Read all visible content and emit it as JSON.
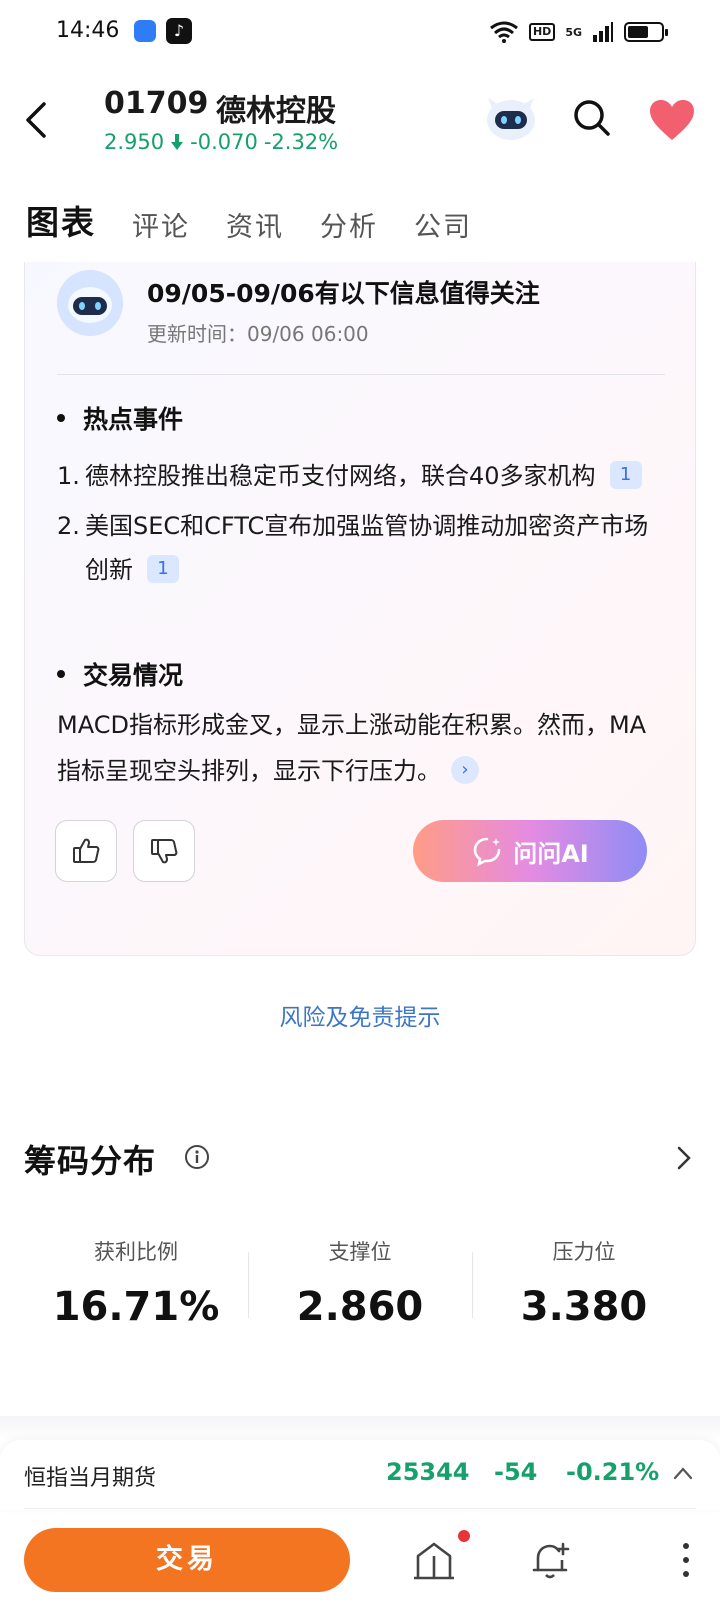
{
  "status_bar": {
    "time": "14:46",
    "hd": "HD",
    "network": "5G"
  },
  "header": {
    "code": "01709",
    "name": "德林控股",
    "price": "2.950",
    "change": "-0.070",
    "change_pct": "-2.32%",
    "colors": {
      "down": "#16a06b",
      "heart": "#f2606f"
    }
  },
  "tabs": [
    {
      "label": "图表",
      "active": true
    },
    {
      "label": "评论"
    },
    {
      "label": "资讯"
    },
    {
      "label": "分析"
    },
    {
      "label": "公司"
    }
  ],
  "ai_card": {
    "title": "09/05-09/06有以下信息值得关注",
    "updated": "更新时间：09/06 06:00",
    "hot_events_heading": "热点事件",
    "hot_events": [
      {
        "num": "1.",
        "text": "德林控股推出稳定币支付网络，联合40多家机构",
        "ref": "1"
      },
      {
        "num": "2.",
        "text": "美国SEC和CFTC宣布加强监管协调推动加密资产市场创新",
        "ref": "1"
      }
    ],
    "trading_heading": "交易情况",
    "trading_text": "MACD指标形成金叉，显示上涨动能在积累。然而，MA指标呈现空头排列，显示下行压力。",
    "ask_ai_label": "问问AI",
    "icons": {
      "like": "thumbs-up-icon",
      "dislike": "thumbs-down-icon",
      "more": "chevron-right-icon"
    }
  },
  "risk_link": "风险及免责提示",
  "chip_distribution": {
    "title": "筹码分布",
    "metrics": [
      {
        "label": "获利比例",
        "value": "16.71%"
      },
      {
        "label": "支撑位",
        "value": "2.860"
      },
      {
        "label": "压力位",
        "value": "3.380"
      }
    ]
  },
  "futures": {
    "name": "恒指当月期货",
    "price": "25344",
    "change": "-54",
    "change_pct": "-0.21%"
  },
  "bottom_bar": {
    "trade_label": "交易",
    "trade_color": "#f37421"
  }
}
